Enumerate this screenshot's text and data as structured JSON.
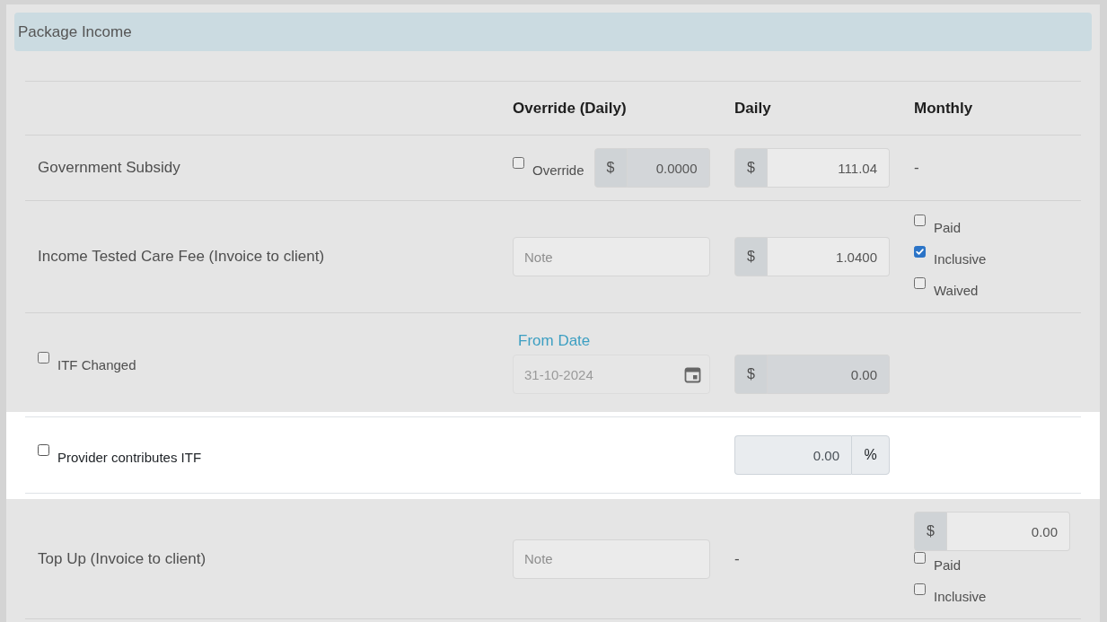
{
  "section": {
    "title": "Package Income"
  },
  "table": {
    "columns": [
      "Override (Daily)",
      "Daily",
      "Monthly"
    ],
    "rows": [
      {
        "kind": "plain",
        "label": "Government Subsidy",
        "highlighted": false,
        "override": {
          "kind": "override",
          "checked": false,
          "label": "Override",
          "addon": "$",
          "value": "0.0000",
          "disabled": true
        },
        "daily": {
          "kind": "currency",
          "addon": "$",
          "value": "111.04",
          "disabled": false
        },
        "monthly": {
          "kind": "text",
          "text": "-"
        }
      },
      {
        "kind": "plain",
        "label": "Income Tested Care Fee (Invoice to client)",
        "highlighted": false,
        "override": {
          "kind": "note",
          "placeholder": "Note"
        },
        "daily": {
          "kind": "currency",
          "addon": "$",
          "value": "1.0400",
          "disabled": false
        },
        "monthly": {
          "kind": "options",
          "options": [
            {
              "label": "Paid",
              "checked": false
            },
            {
              "label": "Inclusive",
              "checked": true
            },
            {
              "label": "Waived",
              "checked": false
            }
          ]
        }
      },
      {
        "kind": "check",
        "label": "ITF Changed",
        "checked": false,
        "highlighted": false,
        "override": {
          "kind": "date",
          "label": "From Date",
          "value": "31-10-2024",
          "disabled": true
        },
        "daily": {
          "kind": "currency",
          "addon": "$",
          "value": "0.00",
          "disabled": true
        }
      },
      {
        "kind": "check",
        "label": "Provider contributes ITF",
        "checked": false,
        "highlighted": true,
        "daily": {
          "kind": "percent",
          "addon": "%",
          "value": "0.00",
          "disabled": true
        }
      },
      {
        "kind": "plain",
        "label": "Top Up (Invoice to client)",
        "highlighted": false,
        "override": {
          "kind": "note",
          "placeholder": "Note"
        },
        "daily": {
          "kind": "text",
          "text": "-"
        },
        "monthly": {
          "kind": "options",
          "amount": {
            "addon": "$",
            "value": "0.00",
            "disabled": false
          },
          "options": [
            {
              "label": "Paid",
              "checked": false
            },
            {
              "label": "Inclusive",
              "checked": false
            }
          ]
        }
      }
    ]
  }
}
